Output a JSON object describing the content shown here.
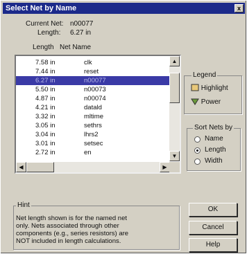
{
  "window": {
    "title": "Select Net by Name",
    "close_glyph": "x"
  },
  "info": {
    "current_net_label": "Current Net:",
    "current_net_value": "n00077",
    "length_label": "Length:",
    "length_value": "6.27 in"
  },
  "list": {
    "col_length": "Length",
    "col_name": "Net Name",
    "selected_index": 2,
    "rows": [
      {
        "length": "7.58 in",
        "name": "clk"
      },
      {
        "length": "7.44 in",
        "name": "reset"
      },
      {
        "length": "6.27 in",
        "name": "n00077"
      },
      {
        "length": "5.50 in",
        "name": "n00073"
      },
      {
        "length": "4.87 in",
        "name": "n00074"
      },
      {
        "length": "4.21 in",
        "name": "datald"
      },
      {
        "length": "3.32 in",
        "name": "mltime"
      },
      {
        "length": "3.05 in",
        "name": "sethrs"
      },
      {
        "length": "3.04 in",
        "name": "lhrs2"
      },
      {
        "length": "3.01 in",
        "name": "setsec"
      },
      {
        "length": "2.72 in",
        "name": "en"
      }
    ]
  },
  "legend": {
    "title": "Legend",
    "highlight": "Highlight",
    "power": "Power"
  },
  "sort": {
    "title": "Sort Nets by",
    "options": [
      "Name",
      "Length",
      "Width"
    ],
    "selected": "Length"
  },
  "hint": {
    "title": "Hint",
    "lines": [
      "Net length shown is for the named net",
      "only.  Nets associated through other",
      "components (e.g., series resistors) are",
      "NOT included in length calculations."
    ]
  },
  "buttons": {
    "ok": "OK",
    "cancel": "Cancel",
    "help": "Help"
  }
}
